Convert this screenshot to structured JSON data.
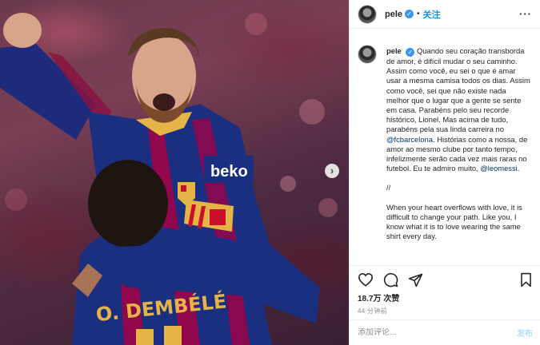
{
  "photo": {
    "jersey_sponsor": "beko",
    "jersey_name": "O. DEMBÉLÉ"
  },
  "header": {
    "username": "pele",
    "verified_mark": "✓",
    "separator": "•",
    "follow_label": "关注",
    "more_label": "···"
  },
  "caption": {
    "username": "pele",
    "verified_mark": "✓",
    "pt_part1": "Quando seu coração transborda de amor, é difícil mudar o seu caminho. Assim como você, eu sei o que é amar usar a mesma camisa todos os dias. Assim como você, sei que não existe nada melhor que o lugar que a gente se sente em casa. Parabéns pelo seu recorde histórico, Lionel. Mas acima de tudo, parabéns pela sua linda carreira no ",
    "mention_club": "@fcbarcelona",
    "pt_part2": ". Histórias como a nossa, de amor ao mesmo clube por tanto tempo, infelizmente serão cada vez mais raras no futebol. Eu te admiro muito, ",
    "mention_player": "@leomessi",
    "pt_end": ".",
    "divider": "//",
    "en_text": "When your heart overflows with love, it is difficult to change your path. Like you, I know what it is to love wearing the same shirt every day."
  },
  "actions": {
    "like_icon": "heart-icon",
    "comment_icon": "comment-icon",
    "share_icon": "paper-plane-icon",
    "save_icon": "bookmark-icon",
    "likes_text": "18.7万 次赞",
    "time_ago": "44 分钟前"
  },
  "comment": {
    "placeholder": "添加评论...",
    "post_label": "发布"
  },
  "colors": {
    "accent": "#0095f6",
    "verified": "#3897f0",
    "link": "#00376b",
    "barca_blue": "#1b2f80",
    "barca_red": "#a50044"
  }
}
